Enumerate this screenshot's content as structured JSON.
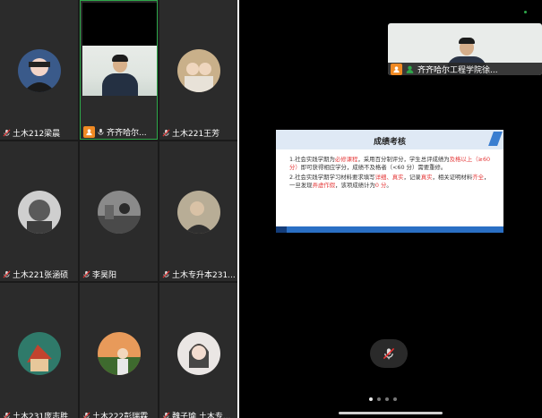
{
  "participants": [
    {
      "name": "土木212梁晨"
    },
    {
      "name": "齐齐哈尔..."
    },
    {
      "name": "土木221王芳"
    },
    {
      "name": "土木221张涵硕"
    },
    {
      "name": "李昊阳"
    },
    {
      "name": "土木专升本231..."
    },
    {
      "name": "土木231庞志胜"
    },
    {
      "name": "土木222彭瑞霖"
    },
    {
      "name": "魏子瑜 土木专..."
    }
  ],
  "pip": {
    "name": "齐齐哈尔工程学院徐..."
  },
  "slide": {
    "title": "成绩考核",
    "p1_a": "1.社会实践学期为",
    "p1_red1": "必修课程",
    "p1_b": "，采用百分制评分，学生总评成绩为",
    "p1_red2": "及格以上（≥60 分）",
    "p1_c": "即可获得相应学分，成绩不及格者（<60 分）需要重修。",
    "p2_a": "2.社会实践学期学习材料要求填写",
    "p2_red1": "详细、真实",
    "p2_b": "，记录",
    "p2_red2": "真实",
    "p2_c": "，相关证明材料",
    "p2_red3": "齐全",
    "p2_d": "，一旦发现",
    "p2_red4": "弄虚作假",
    "p2_e": "，该项成绩计为",
    "p2_red5": "0 分",
    "p2_f": "。"
  },
  "pager": {
    "count": 4,
    "active_index": 0
  },
  "colors": {
    "grid_bg": "#1a1a1a",
    "tile_bg": "#2b2b2b",
    "host_badge": "#f08a23",
    "active_border": "#2ea84a",
    "slide_accent": "#2a6fc4",
    "emphasis_red": "#e53a3a"
  }
}
